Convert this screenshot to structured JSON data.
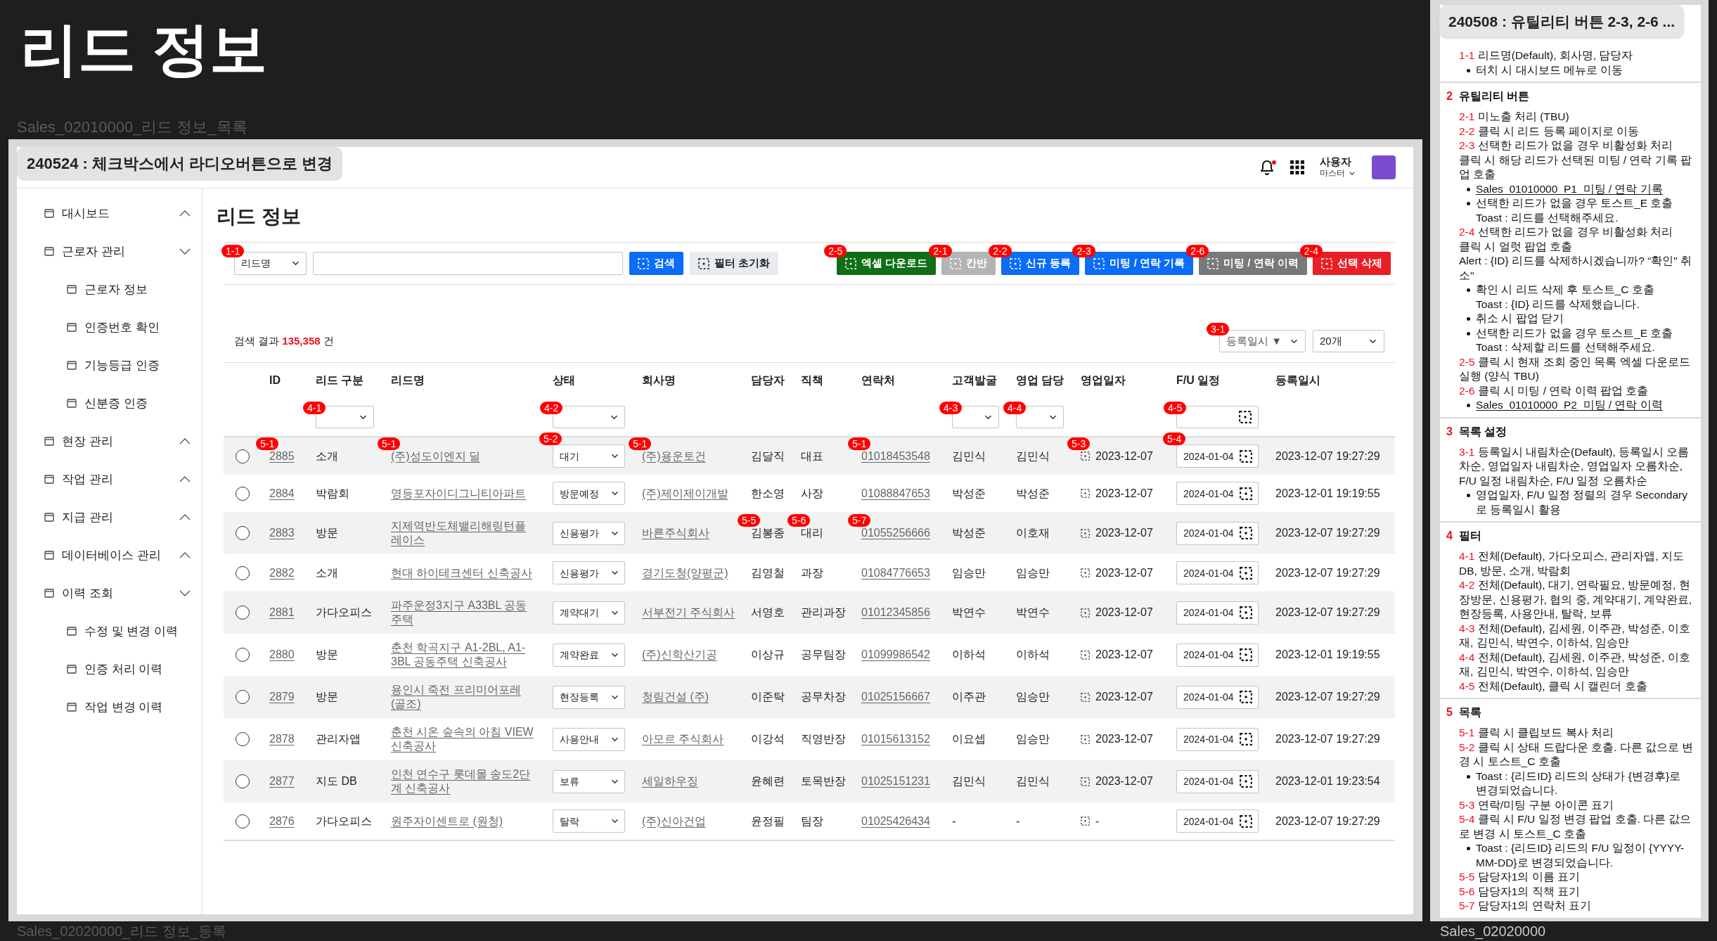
{
  "canvas": {
    "title": "리드 정보",
    "frame_label": "Sales_02010000_리드 정보_목록",
    "bottom_left_label": "Sales_02020000_리드 정보_등록",
    "bottom_right_label": "Sales_02020000"
  },
  "version_tag": "240524 : 체크박스에서 라디오버튼으로 변경",
  "header": {
    "has_notification": true,
    "user_name": "사용자",
    "user_role": "마스터"
  },
  "sidebar": {
    "items": [
      {
        "label": "대시보드",
        "selected": false,
        "expanded": false
      },
      {
        "label": "근로자 관리",
        "selected": false,
        "expanded": true,
        "children": [
          {
            "label": "근로자 정보",
            "selected": false
          },
          {
            "label": "인증번호 확인",
            "selected": false
          },
          {
            "label": "기능등급 인증",
            "selected": false
          },
          {
            "label": "신분증 인증",
            "selected": false
          }
        ]
      },
      {
        "label": "현장 관리",
        "selected": false,
        "expanded": false
      },
      {
        "label": "작업 관리",
        "selected": false,
        "expanded": false
      },
      {
        "label": "지급 관리",
        "selected": false,
        "expanded": false
      },
      {
        "label": "데이터베이스 관리",
        "selected": false,
        "expanded": false
      },
      {
        "label": "이력 조회",
        "selected": false,
        "expanded": true,
        "children": [
          {
            "label": "수정 및 변경 이력",
            "selected": false
          },
          {
            "label": "인증 처리 이력",
            "selected": false
          },
          {
            "label": "작업 변경 이력",
            "selected": false
          }
        ]
      }
    ]
  },
  "page": {
    "title": "리드 정보",
    "search": {
      "field": {
        "value": "리드명",
        "badge": "1-1"
      },
      "button": "검색",
      "reset": "필터 초기화"
    },
    "actions": [
      {
        "label": "엑셀 다운로드",
        "badge": "2-5",
        "kind": "success"
      },
      {
        "label": "칸반",
        "badge": "2-1",
        "kind": "muted"
      },
      {
        "label": "신규 등록",
        "badge": "2-2",
        "kind": "primary"
      },
      {
        "label": "미팅 / 연락 기록",
        "badge": "2-3",
        "kind": "primary"
      },
      {
        "label": "미팅 / 연락 이력",
        "badge": "2-6",
        "kind": "secondary"
      },
      {
        "label": "선택 삭제",
        "badge": "2-4",
        "kind": "danger"
      }
    ],
    "result": {
      "label": "검색 결과",
      "count": "135,358",
      "unit": "건"
    },
    "sort": {
      "value": "등록일시 ▼",
      "badge": "3-1"
    },
    "page_size": {
      "value": "20개"
    },
    "table": {
      "columns": [
        {
          "label": "ID"
        },
        {
          "label": "리드 구분",
          "filter": {
            "kind": "select",
            "badge": "4-1"
          }
        },
        {
          "label": "리드명"
        },
        {
          "label": "상태",
          "filter": {
            "kind": "select",
            "badge": "4-2"
          }
        },
        {
          "label": "회사명"
        },
        {
          "label": "담당자"
        },
        {
          "label": "직책"
        },
        {
          "label": "연락처"
        },
        {
          "label": "고객발굴",
          "filter": {
            "kind": "select",
            "badge": "4-3"
          }
        },
        {
          "label": "영업 담당",
          "filter": {
            "kind": "select",
            "badge": "4-4"
          }
        },
        {
          "label": "영업일자"
        },
        {
          "label": "F/U 일정",
          "filter": {
            "kind": "date",
            "badge": "4-5"
          }
        },
        {
          "label": "등록일시"
        }
      ],
      "rows": [
        {
          "selected": false,
          "id": "2885",
          "type": "소개",
          "name": "(주)성도이엔지 딜",
          "status": "대기",
          "company": "(주)용운토건",
          "manager": "김달직",
          "position": "대표",
          "phone": "01018453548",
          "scout": "김민식",
          "sales_rep": "김민식",
          "sales_date": "2023-12-07",
          "fu_date": "2024-01-04",
          "registered": "2023-12-07 19:27:29",
          "badges": {
            "id": "5-1",
            "name": "5-1",
            "status": "5-2",
            "company": "5-1",
            "phone": "5-1",
            "sales_date": "5-3",
            "fu_date": "5-4"
          }
        },
        {
          "selected": false,
          "id": "2884",
          "type": "박람회",
          "name": "영등포자이디그니티아파트",
          "status": "방문예정",
          "company": "(주)제이제이개발",
          "manager": "한소영",
          "position": "사장",
          "phone": "01088847653",
          "scout": "박성준",
          "sales_rep": "박성준",
          "sales_date": "2023-12-07",
          "fu_date": "2024-01-04",
          "registered": "2023-12-01 19:19:55"
        },
        {
          "selected": false,
          "id": "2883",
          "type": "방문",
          "name": "지제역반도체밸리해링턴플레이스",
          "status": "신용평가",
          "company": "바른주식회사",
          "manager": "김봉종",
          "position": "대리",
          "phone": "01055256666",
          "scout": "박성준",
          "sales_rep": "이호재",
          "sales_date": "2023-12-07",
          "fu_date": "2024-01-04",
          "registered": "2023-12-07 19:27:29",
          "badges": {
            "manager": "5-5",
            "position": "5-6",
            "phone": "5-7"
          }
        },
        {
          "selected": false,
          "id": "2882",
          "type": "소개",
          "name": "현대 하이테크센터 신축공사",
          "status": "신용평가",
          "company": "경기도청(양평군)",
          "manager": "김영철",
          "position": "과장",
          "phone": "01084776653",
          "scout": "임승만",
          "sales_rep": "임승만",
          "sales_date": "2023-12-07",
          "fu_date": "2024-01-04",
          "registered": "2023-12-07 19:27:29"
        },
        {
          "selected": false,
          "id": "2881",
          "type": "가다오피스",
          "name": "파주운정3지구 A33BL 공동주택",
          "status": "계약대기",
          "company": "서부전기 주식회사",
          "manager": "서영호",
          "position": "관리과장",
          "phone": "01012345856",
          "scout": "박연수",
          "sales_rep": "박연수",
          "sales_date": "2023-12-07",
          "fu_date": "2024-01-04",
          "registered": "2023-12-07 19:27:29"
        },
        {
          "selected": false,
          "id": "2880",
          "type": "방문",
          "name": "춘천 학곡지구 A1-2BL, A1-3BL 공동주택 신축공사",
          "status": "계약완료",
          "company": "(주)신학산기공",
          "manager": "이상규",
          "position": "공무팀장",
          "phone": "01099986542",
          "scout": "이하석",
          "sales_rep": "이하석",
          "sales_date": "2023-12-07",
          "fu_date": "2024-01-04",
          "registered": "2023-12-01 19:19:55"
        },
        {
          "selected": false,
          "id": "2879",
          "type": "방문",
          "name": "용인시 죽전 프리미어포레 (골조)",
          "status": "현장등록",
          "company": "청림건설 (주)",
          "manager": "이준탁",
          "position": "공무차장",
          "phone": "01025156667",
          "scout": "이주관",
          "sales_rep": "임승만",
          "sales_date": "2023-12-07",
          "fu_date": "2024-01-04",
          "registered": "2023-12-07 19:27:29"
        },
        {
          "selected": false,
          "id": "2878",
          "type": "관리자앱",
          "name": "춘천 시온 숲속의 아침 VIEW 신축공사",
          "status": "사용안내",
          "company": "아모르 주식회사",
          "manager": "이강석",
          "position": "직영반장",
          "phone": "01015613152",
          "scout": "이요셉",
          "sales_rep": "임승만",
          "sales_date": "2023-12-07",
          "fu_date": "2024-01-04",
          "registered": "2023-12-07 19:27:29"
        },
        {
          "selected": false,
          "id": "2877",
          "type": "지도 DB",
          "name": "인천 연수구 롯데몰 송도2단계 신축공사",
          "status": "보류",
          "company": "세일하우징",
          "manager": "윤혜련",
          "position": "토목반장",
          "phone": "01025151231",
          "scout": "김민식",
          "sales_rep": "김민식",
          "sales_date": "2023-12-07",
          "fu_date": "2024-01-04",
          "registered": "2023-12-01 19:23:54"
        },
        {
          "selected": false,
          "id": "2876",
          "type": "가다오피스",
          "name": "원주자이센트로 (원청)",
          "status": "탈락",
          "company": "(주)신아건업",
          "manager": "윤정필",
          "position": "팀장",
          "phone": "01025426434",
          "scout": "-",
          "sales_rep": "-",
          "sales_date": "-",
          "fu_date": "2024-01-04",
          "registered": "2023-12-07 19:27:29"
        }
      ]
    }
  },
  "notes": {
    "tag": "240508 : 유틸리티 버튼 2-3, 2-6 ...",
    "sections": [
      {
        "items": [
          {
            "code": "1-1",
            "lines": [
              "리드명(Default), 회사명, 담당자"
            ],
            "bullets": [
              {
                "kind": "text",
                "lines": [
                  "터치 시 대시보드 메뉴로 이동"
                ]
              }
            ]
          }
        ]
      },
      {
        "number": "2",
        "title": "유틸리티 버튼",
        "items": [
          {
            "code": "2-1",
            "lines": [
              "미노출 처리 (TBU)"
            ]
          },
          {
            "code": "2-2",
            "lines": [
              "클릭 시 리드 등록 페이지로 이동"
            ]
          },
          {
            "code": "2-3",
            "lines": [
              "선택한 리드가 없을 경우 비활성화 처리",
              "클릭 시 해당 리드가 선택된 미팅 / 연락 기록 팝업 호출"
            ],
            "bullets": [
              {
                "kind": "link",
                "lines": [
                  "Sales_01010000_P1_미팅 / 연락 기록"
                ]
              },
              {
                "kind": "text",
                "lines": [
                  "선택한 리드가 없을 경우 토스트_E 호출",
                  "Toast : 리드를 선택해주세요."
                ]
              }
            ]
          },
          {
            "code": "2-4",
            "lines": [
              "선택한 리드가 없을 경우 비활성화 처리",
              "클릭 시 얼럿 팝업 호출",
              "Alert : {ID} 리드를 삭제하시겠습니까? “확인\" 취소\""
            ],
            "bullets": [
              {
                "kind": "text",
                "lines": [
                  "확인 시 리드 삭제 후 토스트_C 호출",
                  "Toast : {ID} 리드를 삭제했습니다."
                ]
              },
              {
                "kind": "text",
                "lines": [
                  "취소 시 팝업 닫기"
                ]
              },
              {
                "kind": "text",
                "lines": [
                  "선택한 리드가 없을 경우 토스트_E 호출",
                  "Toast : 삭제할 리드를 선택해주세요."
                ]
              }
            ]
          },
          {
            "code": "2-5",
            "lines": [
              "클릭 시 현재 조회 중인 목록 엑셀 다운로드 실행 (양식 TBU)"
            ]
          },
          {
            "code": "2-6",
            "lines": [
              "클릭 시 미팅 / 연락 이력 팝업 호출"
            ],
            "bullets": [
              {
                "kind": "link",
                "lines": [
                  "Sales_01010000_P2_미팅 / 연락 이력"
                ]
              }
            ]
          }
        ]
      },
      {
        "number": "3",
        "title": "목록 설정",
        "items": [
          {
            "code": "3-1",
            "lines": [
              "등록일시 내림차순(Default), 등록일시 오름차순, 영업일자 내림차순, 영업일자 오름차순, F/U 일정 내림차순, F/U 일정 오름차순"
            ],
            "bullets": [
              {
                "kind": "text",
                "lines": [
                  "영업일자, F/U 일정 정렬의 경우 Secondary로 등록일시 활용"
                ]
              }
            ]
          }
        ]
      },
      {
        "number": "4",
        "title": "필터",
        "items": [
          {
            "code": "4-1",
            "lines": [
              "전체(Default), 가다오피스, 관리자앱, 지도 DB, 방문, 소개, 박람회"
            ]
          },
          {
            "code": "4-2",
            "lines": [
              "전체(Default), 대기, 연락필요, 방문예정, 현장방문, 신용평가, 협의 중, 계약대기, 계약완료, 현장등록, 사용안내, 탈락, 보류"
            ]
          },
          {
            "code": "4-3",
            "lines": [
              "전체(Default), 김세원, 이주관, 박성준, 이호재, 김민식, 박연수, 이하석, 임승만"
            ]
          },
          {
            "code": "4-4",
            "lines": [
              "전체(Default), 김세원, 이주관, 박성준, 이호재, 김민식, 박연수, 이하석, 임승만"
            ]
          },
          {
            "code": "4-5",
            "lines": [
              "전체(Default), 클릭 시 캘린더 호출"
            ]
          }
        ]
      },
      {
        "number": "5",
        "title": "목록",
        "items": [
          {
            "code": "5-1",
            "lines": [
              "클릭 시 클립보드 복사 처리"
            ]
          },
          {
            "code": "5-2",
            "lines": [
              "클릭 시 상태 드랍다운 호출. 다른 값으로 변경 시 토스트_C 호출"
            ],
            "bullets": [
              {
                "kind": "text",
                "lines": [
                  "Toast : {리드ID} 리드의 상태가 {변경후}로 변경되었습니다."
                ]
              }
            ]
          },
          {
            "code": "5-3",
            "lines": [
              "연락/미팅 구분 아이콘 표기"
            ]
          },
          {
            "code": "5-4",
            "lines": [
              "클릭 시 F/U 일정 변경 팝업 호출. 다른 값으로 변경 시 토스트_C 호출"
            ],
            "bullets": [
              {
                "kind": "text",
                "lines": [
                  "Toast : {리드ID} 리드의 F/U 일정이 {YYYY-MM-DD}로 변경되었습니다."
                ]
              }
            ]
          },
          {
            "code": "5-5",
            "lines": [
              "담당자1의 이름 표기"
            ]
          },
          {
            "code": "5-6",
            "lines": [
              "담당자1의 직책 표기"
            ]
          },
          {
            "code": "5-7",
            "lines": [
              "담당자1의 연락처 표기"
            ]
          }
        ]
      }
    ]
  }
}
